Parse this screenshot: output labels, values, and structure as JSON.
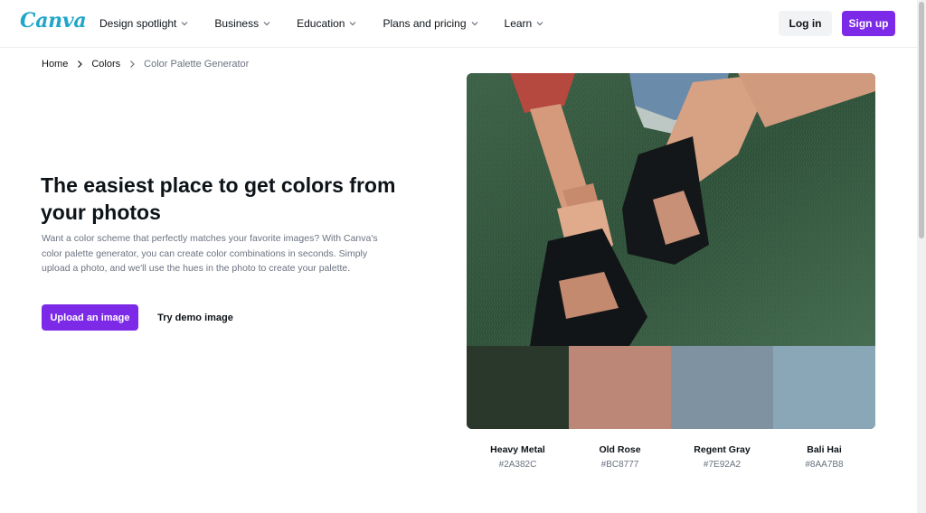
{
  "header": {
    "logo": "Canva",
    "nav": [
      {
        "label": "Design spotlight"
      },
      {
        "label": "Business"
      },
      {
        "label": "Education"
      },
      {
        "label": "Plans and pricing"
      },
      {
        "label": "Learn"
      }
    ],
    "login": "Log in",
    "signup": "Sign up"
  },
  "breadcrumb": [
    "Home",
    "Colors",
    "Color Palette Generator"
  ],
  "hero": {
    "title": "The easiest place to get colors from your photos",
    "description": "Want a color scheme that perfectly matches your favorite images? With Canva's color palette generator, you can create color combinations in seconds. Simply upload a photo, and we'll use the hues in the photo to create your palette.",
    "upload_button": "Upload an image",
    "demo_button": "Try demo image"
  },
  "palette": [
    {
      "name": "Heavy Metal",
      "hex": "#2A382C"
    },
    {
      "name": "Old Rose",
      "hex": "#BC8777"
    },
    {
      "name": "Regent Gray",
      "hex": "#7E92A2"
    },
    {
      "name": "Bali Hai",
      "hex": "#8AA7B8"
    }
  ],
  "colors": {
    "brand_purple": "#7D2AE8",
    "logo": "#1FA6C9"
  }
}
